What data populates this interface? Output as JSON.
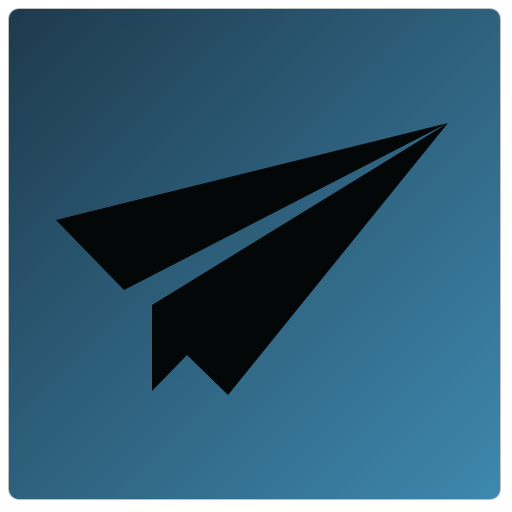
{
  "icon": {
    "name": "paper-plane",
    "description_name": "paper-plane-icon",
    "colors": {
      "background_start": "#1e3a4d",
      "background_end": "#3e88ae",
      "glyph": "#030708"
    }
  }
}
